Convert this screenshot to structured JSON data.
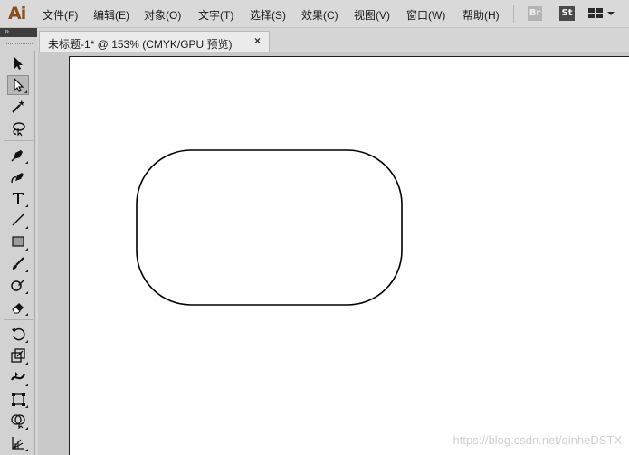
{
  "app": {
    "logo_text": "Ai"
  },
  "menu": {
    "items": [
      {
        "label": "文件(F)"
      },
      {
        "label": "编辑(E)"
      },
      {
        "label": "对象(O)"
      },
      {
        "label": "文字(T)"
      },
      {
        "label": "选择(S)"
      },
      {
        "label": "效果(C)"
      },
      {
        "label": "视图(V)"
      },
      {
        "label": "窗口(W)"
      },
      {
        "label": "帮助(H)"
      }
    ],
    "bridge_label": "Br",
    "stock_label": "St"
  },
  "tools_panel": {
    "collapse_label": "»"
  },
  "document_tab": {
    "title": "未标题-1* @ 153% (CMYK/GPU 预览)",
    "close_symbol": "×"
  },
  "tools": [
    {
      "name": "selection-tool-icon",
      "active": false
    },
    {
      "name": "direct-selection-tool-icon",
      "active": true
    },
    {
      "name": "magic-wand-tool-icon",
      "active": false
    },
    {
      "name": "lasso-tool-icon",
      "active": false
    },
    {
      "name": "pen-tool-icon",
      "active": false
    },
    {
      "name": "curvature-tool-icon",
      "active": false
    },
    {
      "name": "type-tool-icon",
      "active": false
    },
    {
      "name": "line-segment-tool-icon",
      "active": false
    },
    {
      "name": "rectangle-tool-icon",
      "active": false
    },
    {
      "name": "paintbrush-tool-icon",
      "active": false
    },
    {
      "name": "shaper-tool-icon",
      "active": false
    },
    {
      "name": "eraser-tool-icon",
      "active": false
    },
    {
      "name": "rotate-tool-icon",
      "active": false
    },
    {
      "name": "scale-tool-icon",
      "active": false
    },
    {
      "name": "width-tool-icon",
      "active": false
    },
    {
      "name": "free-transform-tool-icon",
      "active": false
    },
    {
      "name": "shape-builder-tool-icon",
      "active": false
    },
    {
      "name": "perspective-grid-tool-icon",
      "active": false
    }
  ],
  "canvas": {
    "shape": "rounded-rectangle",
    "stroke_color": "#000000",
    "fill_color": "#ffffff"
  },
  "watermark": {
    "text": "https://blog.csdn.net/qinheDSTX"
  },
  "colors": {
    "logo": "#8a4d1a",
    "panel": "#d2d2d2",
    "artboard": "#ffffff"
  }
}
